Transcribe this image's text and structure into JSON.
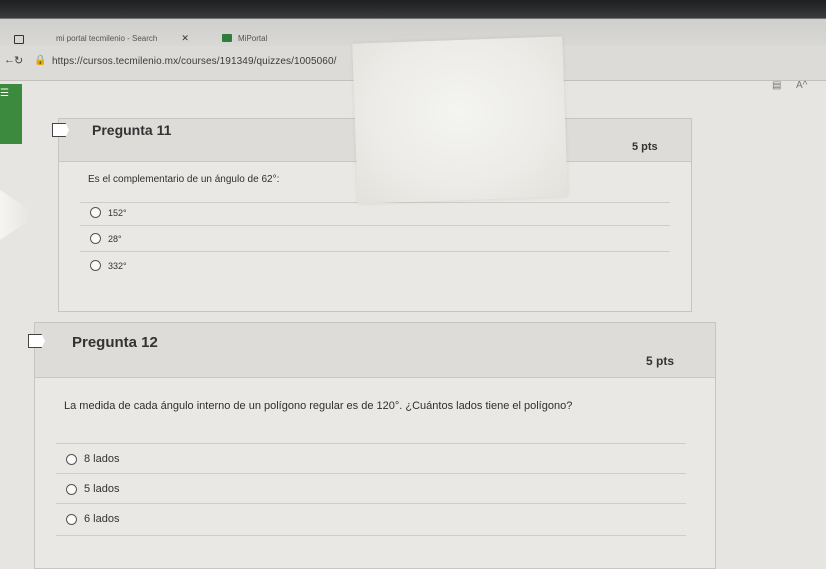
{
  "browser": {
    "tabs": [
      {
        "label": "mi portal tecmilenio - Search"
      },
      {
        "label": "MiPortal"
      }
    ],
    "url": "https://cursos.tecmilenio.mx/courses/191349/quizzes/1005060/"
  },
  "questions": [
    {
      "title": "Pregunta 11",
      "points": "5 pts",
      "text": "Es el complementario de un ángulo de 62°:",
      "answers": [
        "152°",
        "28°",
        "332°"
      ]
    },
    {
      "title": "Pregunta 12",
      "points": "5 pts",
      "text": "La medida de cada ángulo interno de un polígono regular es de 120°. ¿Cuántos lados tiene el polígono?",
      "answers": [
        "8 lados",
        "5 lados",
        "6 lados"
      ]
    }
  ]
}
